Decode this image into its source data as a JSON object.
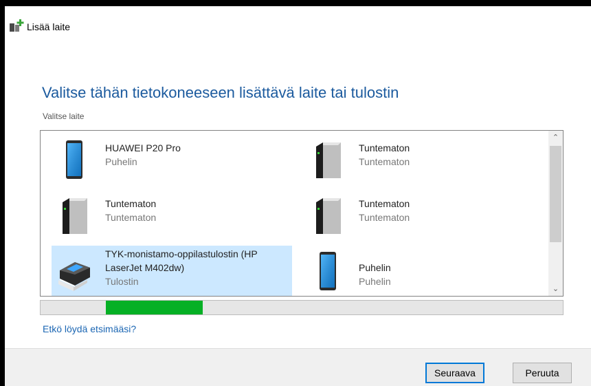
{
  "window": {
    "title": "Lisää laite"
  },
  "main": {
    "heading": "Valitse tähän tietokoneeseen lisättävä laite tai tulostin",
    "subheading": "Valitse laite",
    "devices": [
      {
        "name": "HUAWEI P20 Pro",
        "type": "Puhelin",
        "icon": "phone-icon"
      },
      {
        "name": "Tuntematon",
        "type": "Tuntematon",
        "icon": "computer-tower-icon"
      },
      {
        "name": "Tuntematon",
        "type": "Tuntematon",
        "icon": "computer-tower-icon"
      },
      {
        "name": "Tuntematon",
        "type": "Tuntematon",
        "icon": "computer-tower-icon"
      },
      {
        "name": "TYK-monistamo-oppilastulostin (HP LaserJet M402dw)",
        "type": "Tulostin",
        "icon": "printer-icon",
        "selected": true
      },
      {
        "name": "Puhelin",
        "type": "Puhelin",
        "icon": "phone-icon"
      }
    ],
    "progress": {
      "fill_start": 0.125,
      "fill_end": 0.31
    },
    "help_link": "Etkö löydä etsimääsi?"
  },
  "footer": {
    "next_label": "Seuraava",
    "cancel_label": "Peruuta"
  },
  "colors": {
    "heading": "#1b5a9e",
    "selection": "#cce8ff",
    "progress": "#06b025",
    "link": "#1b66b3"
  }
}
